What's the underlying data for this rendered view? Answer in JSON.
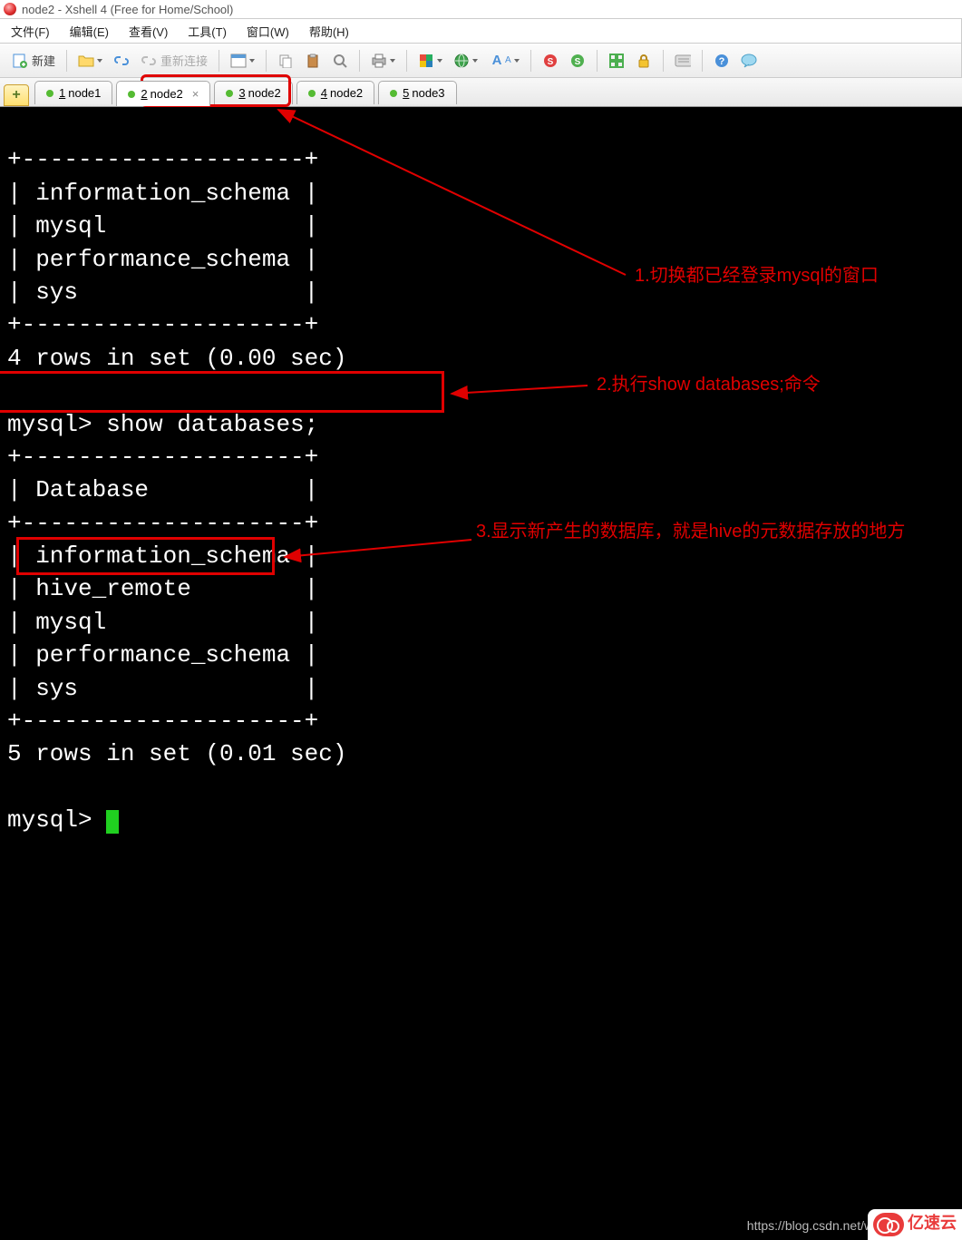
{
  "window": {
    "title": "node2 - Xshell 4 (Free for Home/School)"
  },
  "menu": {
    "file": "文件(F)",
    "edit": "编辑(E)",
    "view": "查看(V)",
    "tool": "工具(T)",
    "window": "窗口(W)",
    "help": "帮助(H)"
  },
  "toolbar": {
    "new": "新建",
    "reconnect": "重新连接"
  },
  "tabs": [
    {
      "num": "1",
      "label": "node1",
      "active": false,
      "close": false
    },
    {
      "num": "2",
      "label": "node2",
      "active": true,
      "close": true
    },
    {
      "num": "3",
      "label": "node2",
      "active": false,
      "close": false
    },
    {
      "num": "4",
      "label": "node2",
      "active": false,
      "close": false
    },
    {
      "num": "5",
      "label": "node3",
      "active": false,
      "close": false
    }
  ],
  "terminal": {
    "lines": [
      "+--------------------+",
      "| information_schema |",
      "| mysql              |",
      "| performance_schema |",
      "| sys                |",
      "+--------------------+",
      "4 rows in set (0.00 sec)",
      "",
      "mysql> show databases;",
      "+--------------------+",
      "| Database           |",
      "+--------------------+",
      "| information_schema |",
      "| hive_remote        |",
      "| mysql              |",
      "| performance_schema |",
      "| sys                |",
      "+--------------------+",
      "5 rows in set (0.01 sec)",
      "",
      "mysql> "
    ]
  },
  "annotations": {
    "a1": "1.切换都已经登录mysql的窗口",
    "a2": "2.执行show databases;命令",
    "a3": "3.显示新产生的数据库，就是hive的元数据存放的地方"
  },
  "footer": {
    "url": "https://blog.csdn.net/weix",
    "brand": "亿速云"
  }
}
